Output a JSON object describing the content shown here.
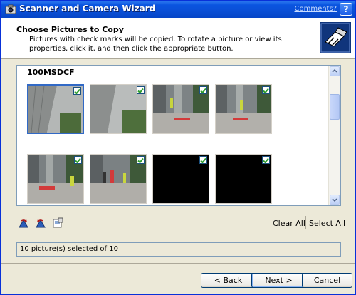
{
  "window": {
    "title": "Scanner and Camera Wizard",
    "comments_link": "Comments?",
    "help_label": "?"
  },
  "header": {
    "title": "Choose Pictures to Copy",
    "description": "Pictures with check marks will be copied. To rotate a picture or view its properties, click it, and then click the appropriate button."
  },
  "gallery": {
    "folder": "100MSDCF",
    "thumbnails": [
      {
        "kind": "building",
        "checked": true,
        "selected": true
      },
      {
        "kind": "building",
        "checked": true,
        "selected": false
      },
      {
        "kind": "plaza",
        "checked": true,
        "selected": false
      },
      {
        "kind": "plaza",
        "checked": true,
        "selected": false
      },
      {
        "kind": "plaza",
        "checked": true,
        "selected": false
      },
      {
        "kind": "plaza",
        "checked": true,
        "selected": false
      },
      {
        "kind": "black",
        "checked": true,
        "selected": false
      },
      {
        "kind": "black",
        "checked": true,
        "selected": false
      }
    ]
  },
  "toolbar": {
    "icons": [
      "rotate-clockwise-icon",
      "rotate-counterclockwise-icon",
      "properties-icon"
    ],
    "clear_all": "Clear All",
    "select_all": "Select All"
  },
  "status": {
    "text": "10 picture(s) selected of 10"
  },
  "buttons": {
    "back": "< Back",
    "next": "Next >",
    "cancel": "Cancel"
  },
  "colors": {
    "titlebar": "#0a55e0",
    "check": "#2e9e2e",
    "selection": "#3169c6"
  }
}
